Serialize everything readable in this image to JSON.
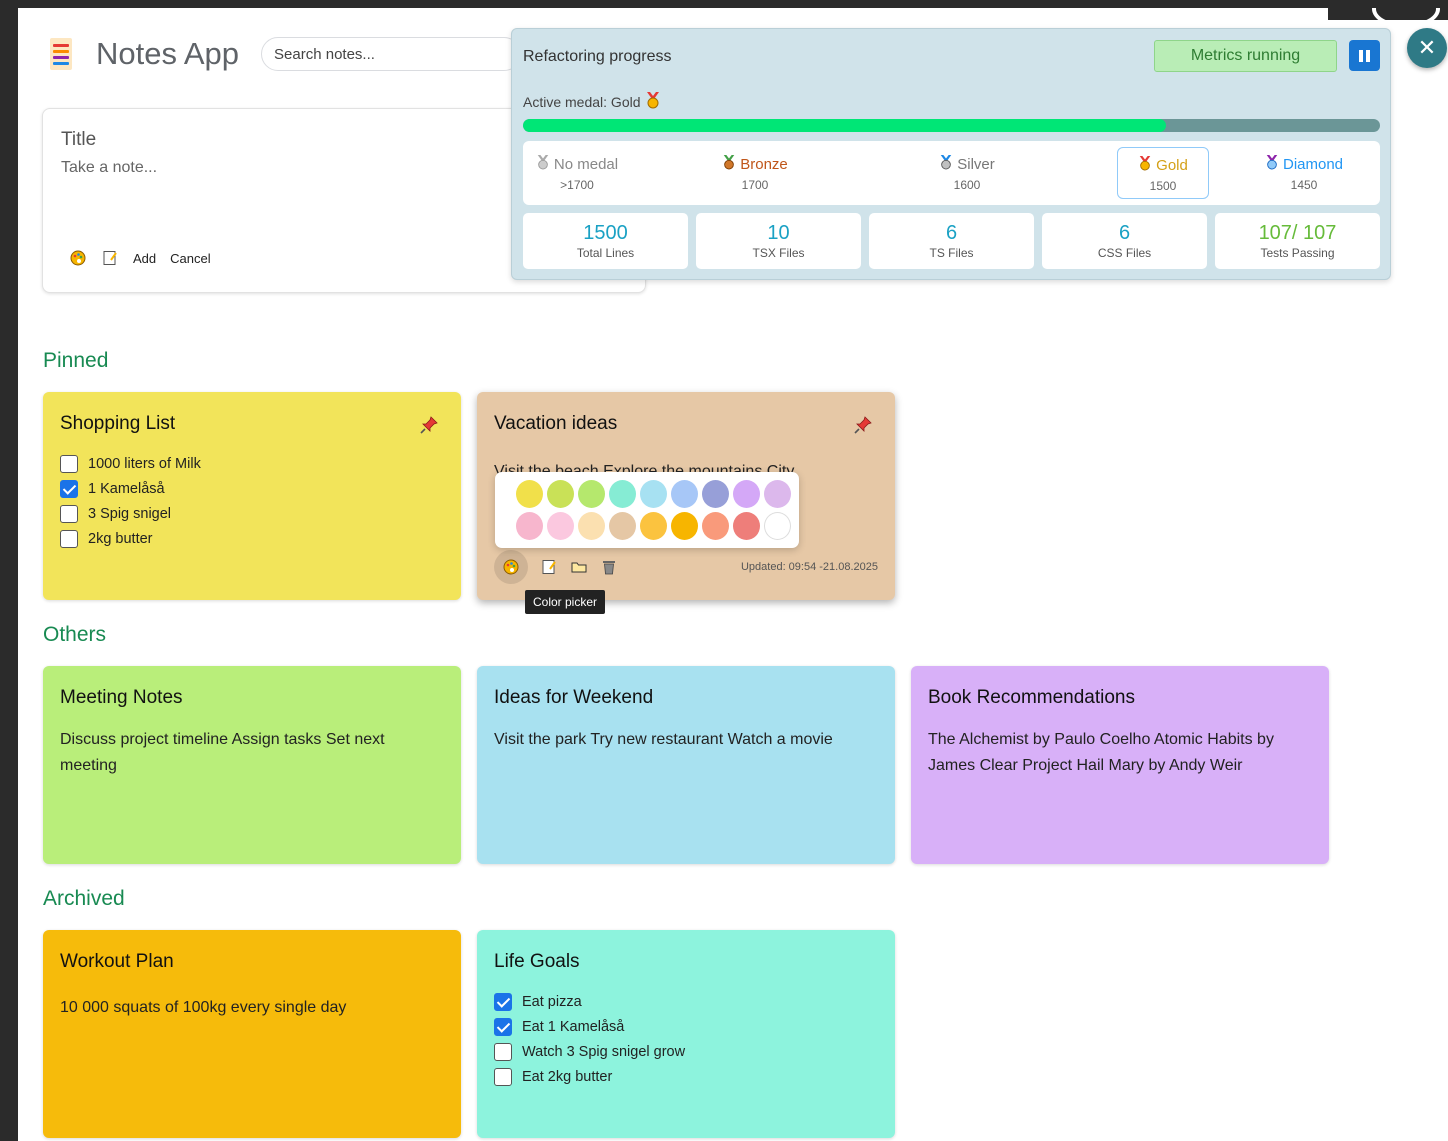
{
  "header": {
    "title": "Notes App",
    "search_placeholder": "Search notes..."
  },
  "composer": {
    "title_placeholder": "Title",
    "body_placeholder": "Take a note...",
    "add_label": "Add",
    "cancel_label": "Cancel"
  },
  "metrics": {
    "title": "Refactoring progress",
    "status": "Metrics running",
    "active_medal_label": "Active medal: Gold",
    "progress_fraction": 0.75,
    "medals": [
      {
        "name": "No medal",
        "value": ">1700",
        "color": "#888888"
      },
      {
        "name": "Bronze",
        "value": "1700",
        "color": "#c0561a"
      },
      {
        "name": "Silver",
        "value": "1600",
        "color": "#777777"
      },
      {
        "name": "Gold",
        "value": "1500",
        "color": "#d4a017"
      },
      {
        "name": "Diamond",
        "value": "1450",
        "color": "#2196f3"
      }
    ],
    "stats": [
      {
        "value": "1500",
        "label": "Total Lines"
      },
      {
        "value": "10",
        "label": "TSX Files"
      },
      {
        "value": "6",
        "label": "TS Files"
      },
      {
        "value": "6",
        "label": "CSS Files"
      },
      {
        "value": "107/ 107",
        "label": "Tests Passing"
      }
    ]
  },
  "sections": {
    "pinned": "Pinned",
    "others": "Others",
    "archived": "Archived"
  },
  "notes": {
    "shopping": {
      "title": "Shopping List",
      "color": "#f2e45a",
      "items": [
        {
          "text": "1000 liters of Milk",
          "checked": false
        },
        {
          "text": "1 Kamelåså",
          "checked": true
        },
        {
          "text": "3 Spig snigel",
          "checked": false
        },
        {
          "text": "2kg butter",
          "checked": false
        }
      ]
    },
    "vacation": {
      "title": "Vacation ideas",
      "color": "#e6c8a6",
      "body": "Visit the beach Explore the mountains City",
      "updated": "Updated: 09:54 -21.08.2025",
      "tooltip": "Color picker"
    },
    "meeting": {
      "title": "Meeting Notes",
      "color": "#b9ee7a",
      "body": "Discuss project timeline Assign tasks Set next meeting"
    },
    "weekend": {
      "title": "Ideas for Weekend",
      "color": "#a8e1f0",
      "body": "Visit the park Try new restaurant Watch a movie"
    },
    "books": {
      "title": "Book Recommendations",
      "color": "#d8b0f8",
      "body": "The Alchemist by Paulo Coelho Atomic Habits by James Clear Project Hail Mary by Andy Weir"
    },
    "workout": {
      "title": "Workout Plan",
      "color": "#f6bb0b",
      "body": "10 000 squats of 100kg every single day"
    },
    "goals": {
      "title": "Life Goals",
      "color": "#8df3dd",
      "items": [
        {
          "text": "Eat pizza",
          "checked": true
        },
        {
          "text": "Eat 1 Kamelåså",
          "checked": true
        },
        {
          "text": "Watch 3 Spig snigel grow",
          "checked": false
        },
        {
          "text": "Eat 2kg butter",
          "checked": false
        }
      ]
    }
  },
  "palette": {
    "row1": [
      "#f1e04a",
      "#c9e157",
      "#b5e86d",
      "#86ecd4",
      "#a7e1f2",
      "#a7c7f7",
      "#979fd8",
      "#d4a8f7",
      "#dcb8ec"
    ],
    "row2": [
      "#f7b6cd",
      "#fbc8df",
      "#fbe0b0",
      "#e5c7a5",
      "#fbc33f",
      "#f7b500",
      "#f99a7b",
      "#ee7e7a",
      "#ffffff"
    ]
  }
}
